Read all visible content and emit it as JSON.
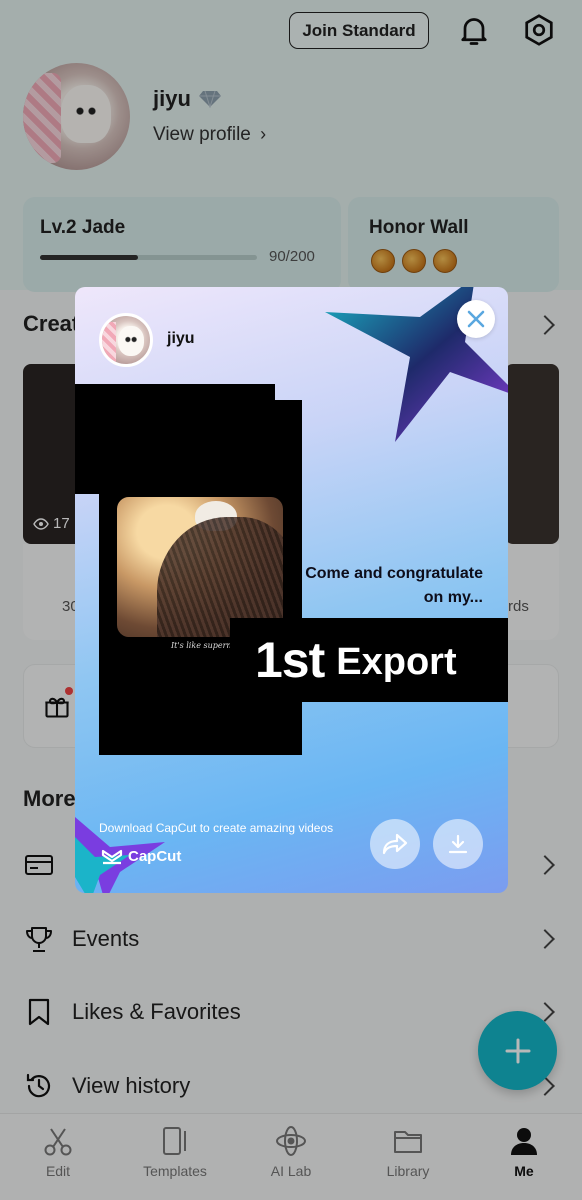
{
  "header": {
    "join_label": "Join Standard"
  },
  "profile": {
    "name": "jiyu",
    "view_profile": "View profile"
  },
  "level_card": {
    "title": "Lv.2 Jade",
    "progress_text": "90/200",
    "progress_fraction": 0.45
  },
  "honor_card": {
    "title": "Honor Wall"
  },
  "creator": {
    "title_partial": "Creat",
    "views_partial": "17",
    "stat_left_partial": "30",
    "stat_right_partial": "rds"
  },
  "more": {
    "title_partial": "More",
    "items": [
      {
        "label": "",
        "icon": "card-icon"
      },
      {
        "label": "Events",
        "icon": "trophy-icon"
      },
      {
        "label": "Likes & Favorites",
        "icon": "bookmark-icon"
      },
      {
        "label": "View history",
        "icon": "history-icon"
      }
    ]
  },
  "tabs": [
    {
      "label": "Edit",
      "icon": "scissors-icon"
    },
    {
      "label": "Templates",
      "icon": "templates-icon"
    },
    {
      "label": "AI Lab",
      "icon": "ai-lab-icon"
    },
    {
      "label": "Library",
      "icon": "folder-icon"
    },
    {
      "label": "Me",
      "icon": "person-icon",
      "active": true
    }
  ],
  "modal": {
    "user_name": "jiyu",
    "congrats_line1": "Come and congratulate",
    "congrats_line2": "on my...",
    "export_number": "1st",
    "export_word": "Export",
    "photo_caption": "It's like supernatural",
    "download_text": "Download CapCut to create amazing videos",
    "brand": "CapCut"
  },
  "colors": {
    "accent": "#14b6c8",
    "star_teal": "#1ab3c7",
    "star_purple": "#6a3fd9"
  }
}
